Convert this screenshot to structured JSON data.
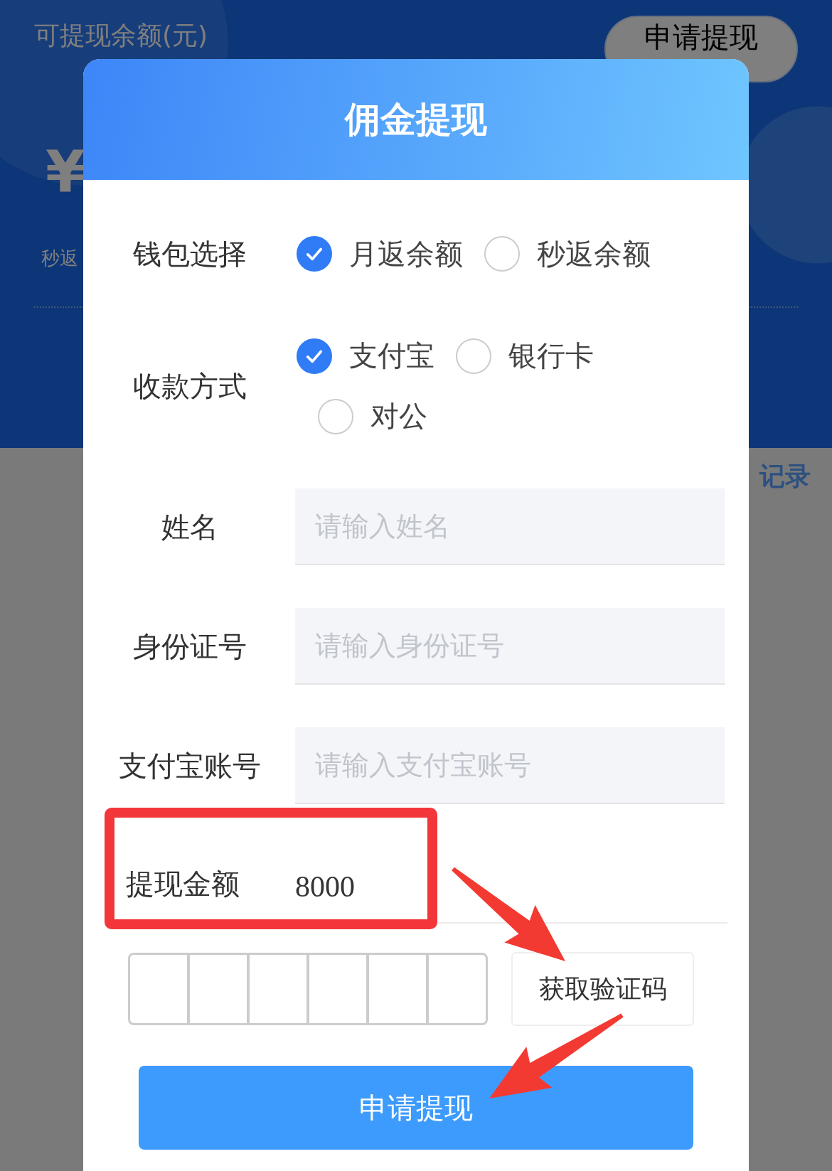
{
  "background": {
    "balance_label": "可提现余额(元)",
    "apply_button": "申请提现",
    "currency": "¥",
    "sub_label": "秒返",
    "records_link": "记录"
  },
  "dialog": {
    "title": "佣金提现",
    "fields": [
      {
        "kind": "radio",
        "label": "钱包选择",
        "options": [
          {
            "label": "月返余额",
            "selected": true
          },
          {
            "label": "秒返余额",
            "selected": false
          }
        ]
      },
      {
        "kind": "radio",
        "label": "收款方式",
        "options": [
          {
            "label": "支付宝",
            "selected": true
          },
          {
            "label": "银行卡",
            "selected": false
          },
          {
            "label": "对公",
            "selected": false
          }
        ]
      },
      {
        "kind": "input",
        "label": "姓名",
        "placeholder": "请输入姓名"
      },
      {
        "kind": "input",
        "label": "身份证号",
        "placeholder": "请输入身份证号"
      },
      {
        "kind": "input",
        "label": "支付宝账号",
        "placeholder": "请输入支付宝账号"
      },
      {
        "kind": "amount",
        "label": "提现金额",
        "value": "8000",
        "highlighted": true
      }
    ],
    "verification": {
      "cells": [
        {
          "filled": false
        },
        {
          "filled": false
        },
        {
          "filled": false
        },
        {
          "filled": false
        },
        {
          "filled": false
        },
        {
          "filled": false
        }
      ],
      "button": "获取验证码"
    },
    "submit": "申请提现"
  },
  "annotations": [
    {
      "kind": "arrow"
    },
    {
      "kind": "arrow"
    }
  ]
}
